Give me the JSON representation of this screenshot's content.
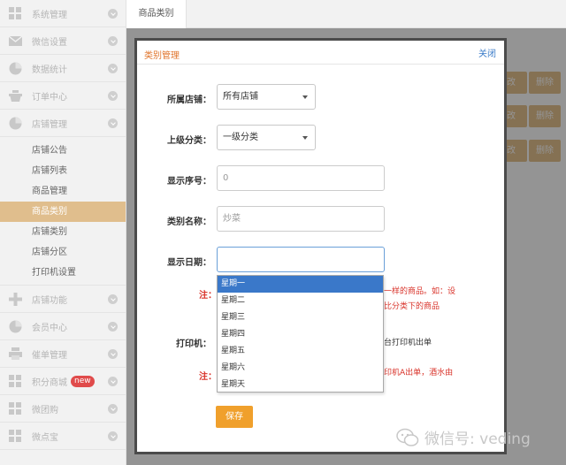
{
  "sidebar": {
    "items_top": [
      {
        "label": "系统管理",
        "icon": "grid-icon"
      },
      {
        "label": "微信设置",
        "icon": "envelope-icon"
      },
      {
        "label": "数据统计",
        "icon": "pie-chart-icon"
      },
      {
        "label": "订单中心",
        "icon": "basket-icon"
      },
      {
        "label": "店铺管理",
        "icon": "pie-chart-icon"
      }
    ],
    "sub_items": [
      {
        "label": "店铺公告"
      },
      {
        "label": "店铺列表"
      },
      {
        "label": "商品管理"
      },
      {
        "label": "商品类别"
      },
      {
        "label": "店铺类别"
      },
      {
        "label": "店铺分区"
      },
      {
        "label": "打印机设置"
      }
    ],
    "items_bottom": [
      {
        "label": "店铺功能",
        "icon": "plus-icon"
      },
      {
        "label": "会员中心",
        "icon": "pie-chart-icon"
      },
      {
        "label": "催单管理",
        "icon": "printer-icon"
      },
      {
        "label": "积分商城",
        "icon": "grid-icon",
        "badge": "new"
      },
      {
        "label": "微团购",
        "icon": "grid-icon"
      },
      {
        "label": "微点宝",
        "icon": "grid-icon"
      }
    ]
  },
  "tabs": {
    "active": "商品类别"
  },
  "background": {
    "btn_edit": "改",
    "btn_delete": "删除"
  },
  "modal": {
    "title": "类别管理",
    "close": "关闭",
    "store_label": "所属店铺：",
    "store_value": "所有店铺",
    "parent_label": "上级分类：",
    "parent_value": "一级分类",
    "order_label": "显示序号：",
    "order_placeholder": "0",
    "name_label": "类别名称：",
    "name_placeholder": "炒菜",
    "date_label": "显示日期：",
    "date_value": "",
    "note1_label": "注：",
    "note1_line1": "一样的商品。如：设",
    "note1_line2": "比分类下的商品",
    "printer_label": "打印机：",
    "printer_text": "台打印机出单",
    "note2_label": "注：",
    "note2_text": "印机A出单，酒水由",
    "weekdays": [
      "星期一",
      "星期二",
      "星期三",
      "星期四",
      "星期五",
      "星期六",
      "星期天"
    ],
    "save": "保存"
  },
  "watermark": {
    "text": "微信号: veding"
  },
  "colors": {
    "accent": "#e0be8d",
    "save": "#f0a02c",
    "title": "#e0742b",
    "note": "#d9342b",
    "selected": "#3a78c9"
  }
}
